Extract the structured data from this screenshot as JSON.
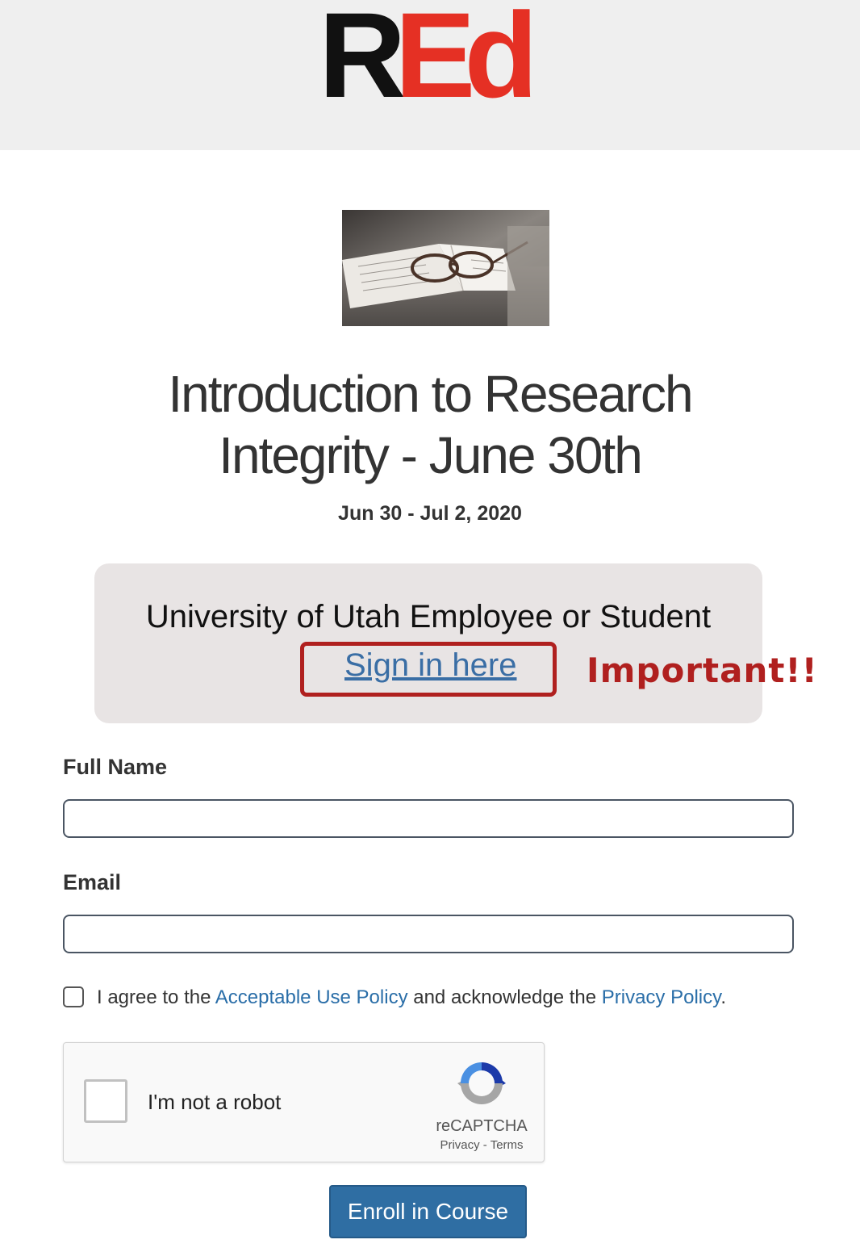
{
  "header": {
    "logo_r": "R",
    "logo_ed": "Ed"
  },
  "course": {
    "title": "Introduction to Research Integrity - June 30th",
    "dates": "Jun 30 - Jul 2, 2020"
  },
  "signin": {
    "heading": "University of Utah Employee or Student",
    "link": "Sign in here",
    "annotation": "Important!!"
  },
  "form": {
    "full_name_label": "Full Name",
    "full_name_value": "",
    "email_label": "Email",
    "email_value": "",
    "agree_prefix": "I agree to the",
    "agree_policy_link": "Acceptable Use Policy",
    "agree_middle": "and acknowledge the",
    "agree_privacy_link": "Privacy Policy",
    "agree_suffix": "."
  },
  "captcha": {
    "label": "I'm not a robot",
    "brand": "reCAPTCHA",
    "privacy": "Privacy",
    "separator": " - ",
    "terms": "Terms"
  },
  "submit_label": "Enroll in Course",
  "colors": {
    "brand_red": "#e53024",
    "annotation_red": "#b0201f",
    "link_blue": "#2a6ea8",
    "button_blue": "#2f6ea3"
  },
  "icons": [
    "recaptcha-icon",
    "glasses-notebook-image"
  ]
}
